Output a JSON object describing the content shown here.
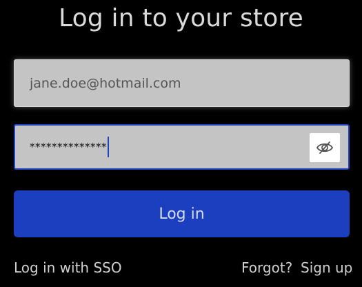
{
  "page": {
    "title": "Log in to your store"
  },
  "form": {
    "email_value": "jane.doe@hotmail.com",
    "password_value": "**************",
    "toggle_icon": "eye-slash-icon",
    "login_label": "Log in"
  },
  "links": {
    "sso": "Log in with SSO",
    "forgot": "Forgot?",
    "signup": "Sign up"
  },
  "colors": {
    "background": "#000000",
    "field_background": "#c4c4c4",
    "accent": "#1b3fbf",
    "focus_border": "#1f45c7"
  }
}
